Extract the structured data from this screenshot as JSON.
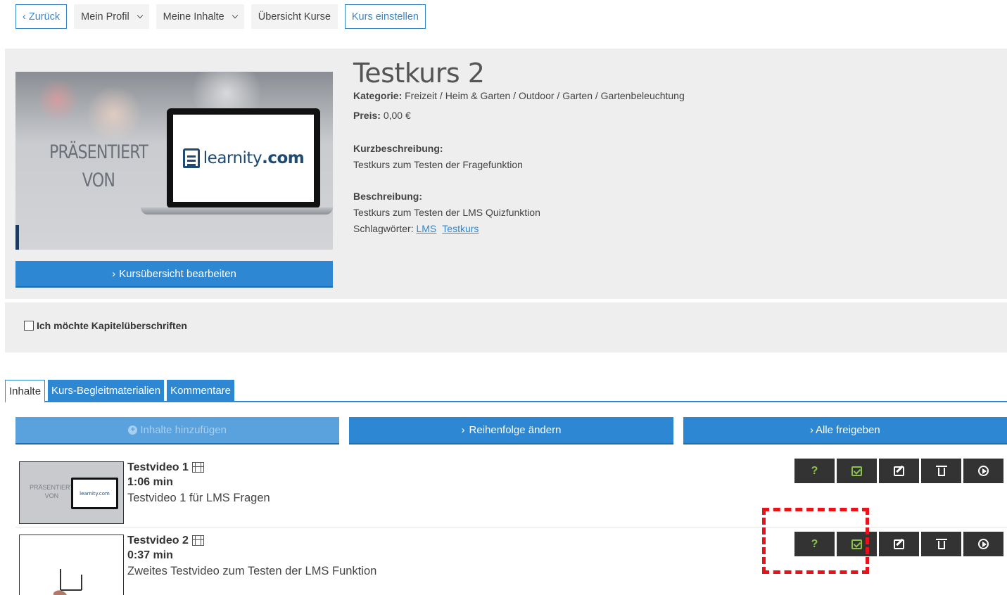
{
  "nav": {
    "back": "‹ Zurück",
    "profile": "Mein Profil",
    "content": "Meine Inhalte",
    "courses": "Übersicht Kurse",
    "publish": "Kurs einstellen"
  },
  "course": {
    "image": {
      "text_line1": "PRÄSENTIERT",
      "text_line2": "VON",
      "logo_text": "learnity",
      "logo_suffix": ".com"
    },
    "edit_overview_label": "Kursübersicht bearbeiten",
    "title": "Testkurs 2",
    "category_label": "Kategorie:",
    "category_value": "Freizeit / Heim & Garten / Outdoor / Garten / Gartenbeleuchtung",
    "price_label": "Preis:",
    "price_value": "0,00 €",
    "short_desc_label": "Kurzbeschreibung:",
    "short_desc": "Testkurs zum Testen der Fragefunktion",
    "desc_label": "Beschreibung:",
    "desc": "Testkurs zum Testen der LMS Quizfunktion",
    "tags_label": "Schlagwörter:",
    "tags": [
      "LMS",
      "Testkurs"
    ]
  },
  "chapters": {
    "checkbox_label": "Ich möchte Kapitelüberschriften",
    "checked": false
  },
  "tabs": [
    {
      "label": "Inhalte",
      "active": true
    },
    {
      "label": "Kurs-Begleitmaterialien",
      "active": false
    },
    {
      "label": "Kommentare",
      "active": false
    }
  ],
  "actions": {
    "add": "Inhalte hinzufügen",
    "reorder": "Reihenfolge ändern",
    "release_all": "Alle freigeben"
  },
  "videos": [
    {
      "title": "Testvideo 1",
      "duration": "1:06 min",
      "description": "Testvideo 1 für LMS Fragen",
      "thumb_text1": "PRÄSENTIERT",
      "thumb_text2": "VON",
      "thumb_logo": "learnity.com"
    },
    {
      "title": "Testvideo 2",
      "duration": "0:37 min",
      "description": "Zweites Testvideo zum Testen der LMS Funktion"
    }
  ],
  "controls": {
    "question": "?",
    "icons": [
      "question-icon",
      "checkbox-icon",
      "edit-icon",
      "trash-icon",
      "play-icon"
    ],
    "question_color": "#8bc34a"
  },
  "colors": {
    "primary": "#2d87d3",
    "highlight": "#e8131a",
    "control_bg": "#333333"
  }
}
